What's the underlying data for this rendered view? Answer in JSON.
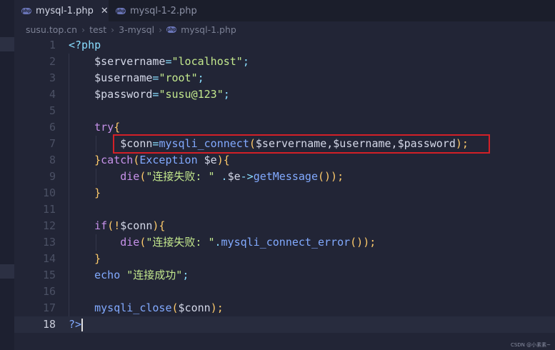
{
  "tabs": [
    {
      "label": "mysql-1.php",
      "active": true,
      "close": "✕"
    },
    {
      "label": "mysql-1-2.php",
      "active": false
    }
  ],
  "file_badge": "php",
  "breadcrumb": [
    "susu.top.cn",
    "test",
    "3-mysql",
    "mysql-1.php"
  ],
  "breadcrumb_separator": "›",
  "line_numbers": [
    "1",
    "2",
    "3",
    "4",
    "5",
    "6",
    "7",
    "8",
    "9",
    "10",
    "11",
    "12",
    "13",
    "14",
    "15",
    "16",
    "17",
    "18"
  ],
  "current_line": "18",
  "code": {
    "l1": "<?php",
    "l2": {
      "var": "$servername",
      "eq": "=",
      "str": "\"localhost\"",
      "end": ";"
    },
    "l3": {
      "var": "$username",
      "eq": "=",
      "str": "\"root\"",
      "end": ";"
    },
    "l4": {
      "var": "$password",
      "eq": "=",
      "str": "\"susu@123\"",
      "end": ";"
    },
    "l6": {
      "kw": "try",
      "brace": "{"
    },
    "l7": {
      "var": "$conn",
      "eq": "=",
      "fn": "mysqli_connect",
      "open": "(",
      "args": "$servername,$username,$password",
      "close": ");"
    },
    "l8": {
      "brace": "}",
      "kw": "catch",
      "open": "(",
      "type": "Exception",
      "var": " $e",
      "close": "){"
    },
    "l9": {
      "fn": "die",
      "open": "(",
      "str": "\"连接失败: \"",
      "op": " .",
      "var": "$e",
      "arrow": "->",
      "method": "getMessage",
      "close": "());"
    },
    "l10": "}",
    "l12": {
      "kw": "if",
      "open": "(!",
      "var": "$conn",
      "close": "){"
    },
    "l13": {
      "fn": "die",
      "open": "(",
      "str": "\"连接失败: \"",
      "op": ".",
      "method": "mysqli_connect_error",
      "close": "());"
    },
    "l14": "}",
    "l15": {
      "kw": "echo",
      "str": " \"连接成功\"",
      "end": ";"
    },
    "l17": {
      "fn": "mysqli_close",
      "open": "(",
      "var": "$conn",
      "close": ");"
    },
    "l18": "?>"
  },
  "watermark": "CSDN @小素素~",
  "colors": {
    "background": "#222536",
    "highlight_box": "#d32027",
    "keyword": "#c792ea",
    "string": "#c3e88d",
    "function": "#82aaff"
  }
}
